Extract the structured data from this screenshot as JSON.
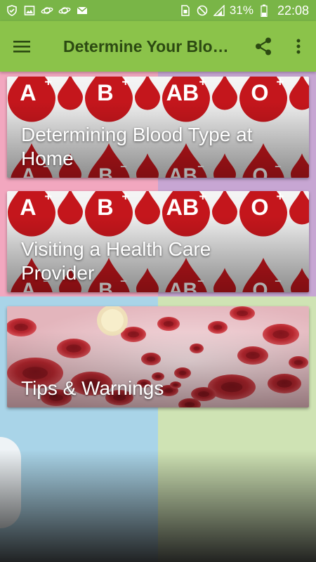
{
  "status_bar": {
    "battery_percent": "31%",
    "time": "22:08",
    "left_icons": [
      "shield-icon",
      "image-icon",
      "planet-icon",
      "planet-icon",
      "mail-icon"
    ],
    "right_icons": [
      "sim-icon",
      "no-disturb-icon",
      "signal-icon",
      "battery-icon"
    ]
  },
  "toolbar": {
    "title": "Determine Your Blood Type",
    "menu_icon": "hamburger-menu-icon",
    "share_icon": "share-icon",
    "more_icon": "more-vert-icon"
  },
  "cards": [
    {
      "title": "Determining Blood Type at Home",
      "image": "blood-type-drops"
    },
    {
      "title": "Visiting a Health Care Provider",
      "image": "blood-type-drops"
    },
    {
      "title": "Tips & Warnings",
      "image": "blood-cells"
    }
  ],
  "blood_types": [
    "A",
    "B",
    "AB",
    "O"
  ],
  "colors": {
    "status_bar": "#79b547",
    "toolbar": "#8bc34a",
    "toolbar_title": "#2c4a12",
    "drop_red": "#c4161c"
  }
}
